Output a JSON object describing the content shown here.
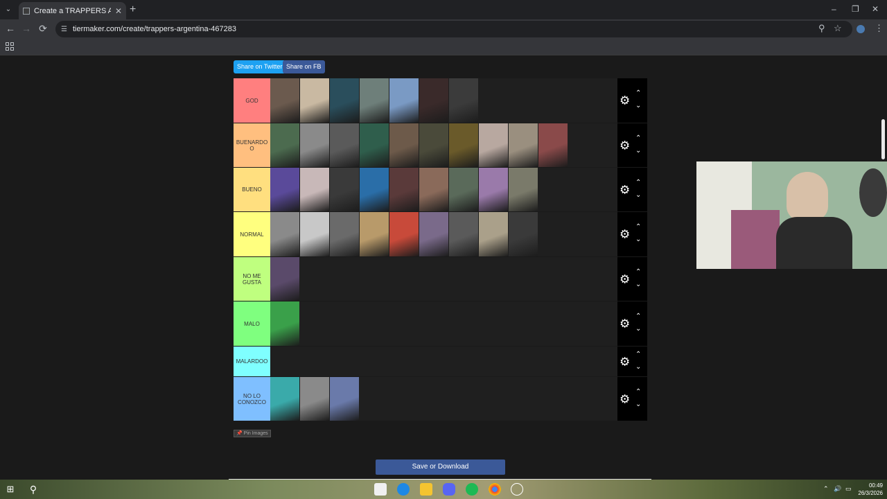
{
  "browser": {
    "tab_title": "Create a TRAPPERS ARGENTIN...",
    "url": "tiermaker.com/create/trappers-argentina-467283",
    "tab_close": "✕",
    "new_tab": "+",
    "icons": {
      "back": "←",
      "forward": "→",
      "reload": "⟳",
      "zoom": "⚲",
      "star": "☆",
      "menu": "⋮",
      "minimize": "–",
      "maximize": "❐",
      "close": "✕",
      "tab_search": "⌄",
      "site_info": "☰"
    }
  },
  "share": {
    "twitter": "Share on Twitter",
    "facebook": "Share on FB"
  },
  "tiers": [
    {
      "label": "GOD",
      "color": "#ff7f7f",
      "height": 65,
      "thumbs": [
        "#6b5a4e",
        "#c9b9a2",
        "#2a4e5c",
        "#6e7f7a",
        "#7a9ac4",
        "#3a2a2a",
        "#3b3b3b"
      ]
    },
    {
      "label": "BUENARDO O",
      "color": "#ffbf7f",
      "height": 64,
      "thumbs": [
        "#4c6b4f",
        "#8a8a8a",
        "#5a5a5a",
        "#2f5e4c",
        "#6d5a4a",
        "#4a4a3a",
        "#6a5a2a",
        "#b8a8a0",
        "#9a8f7f",
        "#8a4a4a"
      ]
    },
    {
      "label": "BUENO",
      "color": "#ffdf7f",
      "height": 64,
      "thumbs": [
        "#5a4a9a",
        "#c8b8b8",
        "#3a3a3a",
        "#2a6ea8",
        "#5a3a3a",
        "#8a6a5a",
        "#5a6a5a",
        "#9a7aaa",
        "#7a7a6a"
      ]
    },
    {
      "label": "NORMAL",
      "color": "#ffff7f",
      "height": 65,
      "thumbs": [
        "#8a8a8a",
        "#c8c8c8",
        "#6a6a6a",
        "#b89a6a",
        "#c84a3a",
        "#7a6a8a",
        "#5a5a5a",
        "#aaa08a",
        "#3a3a3a"
      ]
    },
    {
      "label": "NO ME GUSTA",
      "color": "#bfff7f",
      "height": 64,
      "thumbs": [
        "#5a4a6a"
      ]
    },
    {
      "label": "MALO",
      "color": "#7fff7f",
      "height": 65,
      "thumbs": [
        "#3aa04a"
      ]
    },
    {
      "label": "MALARDOO",
      "color": "#7fffff",
      "height": 44,
      "thumbs": []
    },
    {
      "label": "NO LO CONOZCO",
      "color": "#7fbfff",
      "height": 64,
      "thumbs": [
        "#3aaaaa",
        "#8a8a8a",
        "#6a7aaa"
      ]
    }
  ],
  "controls": {
    "gear": "⚙",
    "up": "⌃",
    "down": "⌄"
  },
  "pin_images": "📌 Pin Images",
  "save_button": "Save or Download",
  "taskbar": {
    "time": "00:49",
    "date": "26/3/2026"
  }
}
